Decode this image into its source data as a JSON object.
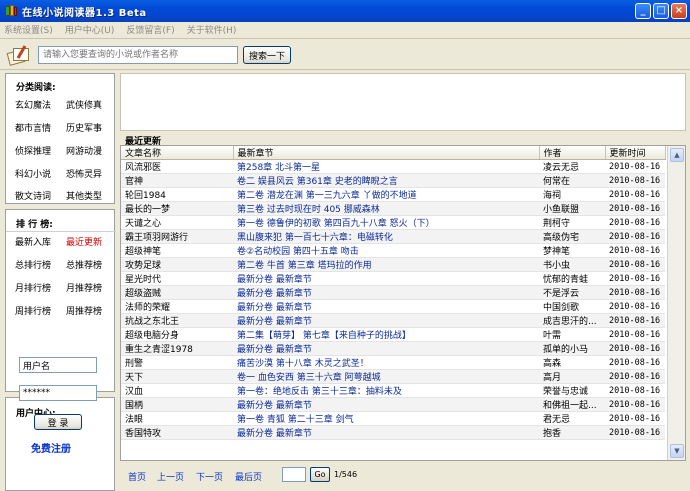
{
  "window": {
    "title": "在线小说阅读器1.3 Beta"
  },
  "menu": [
    "系统设置(S)",
    "用户中心(U)",
    "反馈留言(F)",
    "关于软件(H)"
  ],
  "search": {
    "placeholder": "请输入您要查询的小说或作者名称",
    "button": "搜索一下"
  },
  "categories": {
    "title": "分类阅读:",
    "items": [
      "玄幻魔法",
      "武侠修真",
      "都市言情",
      "历史军事",
      "侦探推理",
      "网游动漫",
      "科幻小说",
      "恐怖灵异",
      "散文诗词",
      "其他类型"
    ]
  },
  "rankings": {
    "title": "排 行 榜:",
    "items": [
      "最新入库",
      "最近更新",
      "总排行榜",
      "总推荐榜",
      "月排行榜",
      "月推荐榜",
      "周排行榜",
      "周推荐榜"
    ],
    "active_index": 1
  },
  "user": {
    "title": "用户中心:",
    "username": "用户名",
    "password": "******",
    "login": "登 录",
    "register": "免费注册"
  },
  "recent": {
    "title": "最近更新",
    "columns": [
      "文章名称",
      "最新章节",
      "作者",
      "更新时间"
    ],
    "rows": [
      {
        "name": "风流邪医",
        "chapter": "第258章 北斗第一星",
        "author": "凌云无忌",
        "time": "2010-08-16"
      },
      {
        "name": "官神",
        "chapter": "卷二 娱县风云 第361章 史老的睥睨之言",
        "author": "何常在",
        "time": "2010-08-16"
      },
      {
        "name": "轮回1984",
        "chapter": "第二卷 潜龙在渊 第一三九六章 丫做的不地道",
        "author": "海祠",
        "time": "2010-08-16"
      },
      {
        "name": "最长的一梦",
        "chapter": "第三卷 过去时现在时 405 挪威森林",
        "author": "小鱼联盟",
        "time": "2010-08-16"
      },
      {
        "name": "天谴之心",
        "chapter": "第一卷 德鲁伊的初歌 第四百九十八章 怒火（下）",
        "author": "荆柯守",
        "time": "2010-08-16"
      },
      {
        "name": "霸王项羽网游行",
        "chapter": "黑山腹来犯 第一百七十六章：电磁转化",
        "author": "高级伪宅",
        "time": "2010-08-16"
      },
      {
        "name": "超级神笔",
        "chapter": "卷②名动校园 第四十五章 吻击",
        "author": "梦神笔",
        "time": "2010-08-16"
      },
      {
        "name": "攻势足球",
        "chapter": "第二卷 牛首 第三章 塔玛拉的作用",
        "author": "书小虫",
        "time": "2010-08-16"
      },
      {
        "name": "星光时代",
        "chapter": "最新分卷 最新章节",
        "author": "忧郁的青蛙",
        "time": "2010-08-16"
      },
      {
        "name": "超级盗贼",
        "chapter": "最新分卷 最新章节",
        "author": "不是浮云",
        "time": "2010-08-16"
      },
      {
        "name": "法师的荣耀",
        "chapter": "最新分卷 最新章节",
        "author": "中国剑歌",
        "time": "2010-08-16"
      },
      {
        "name": "抗战之东北王",
        "chapter": "最新分卷 最新章节",
        "author": "成吉思汗的...",
        "time": "2010-08-16"
      },
      {
        "name": "超级电脑分身",
        "chapter": "第二集【萌芽】 第七章【来自种子的挑战】",
        "author": "叶需",
        "time": "2010-08-16"
      },
      {
        "name": "重生之青涩1978",
        "chapter": "最新分卷 最新章节",
        "author": "孤单的小马",
        "time": "2010-08-16"
      },
      {
        "name": "刑警",
        "chapter": "痛苦沙漠 第十八章 木灵之武圣！",
        "author": "高森",
        "time": "2010-08-16"
      },
      {
        "name": "天下",
        "chapter": "卷一 血色安西 第三十六章 阿萼越城",
        "author": "高月",
        "time": "2010-08-16"
      },
      {
        "name": "汉血",
        "chapter": "第一卷：绝地反击 第三十三章：抽料未及",
        "author": "荣誉与忠诚",
        "time": "2010-08-16"
      },
      {
        "name": "国柄",
        "chapter": "最新分卷 最新章节",
        "author": "和佛祖一起...",
        "time": "2010-08-16"
      },
      {
        "name": "法眼",
        "chapter": "第一卷 青狐 第二十三章 剑气",
        "author": "君无忌",
        "time": "2010-08-16"
      },
      {
        "name": "香国特攻",
        "chapter": "最新分卷 最新章节",
        "author": "抱香",
        "time": "2010-08-16"
      }
    ]
  },
  "pager": {
    "first": "首页",
    "prev": "上一页",
    "next": "下一页",
    "last": "最后页",
    "go": "Go",
    "count": "1/546"
  }
}
